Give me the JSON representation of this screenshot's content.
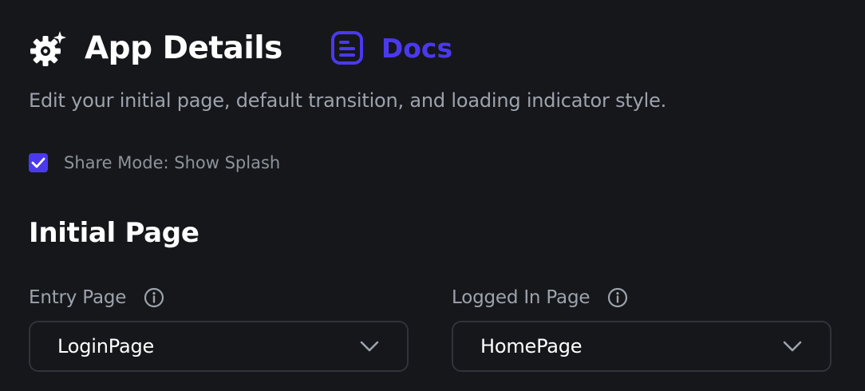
{
  "header": {
    "title": "App Details",
    "docs_label": "Docs",
    "gear_icon": "gear-sparkle-icon",
    "docs_icon": "document-icon",
    "accent_color": "#4b39ef"
  },
  "subtitle": "Edit your initial page, default transition, and loading indicator style.",
  "share_mode": {
    "label": "Share Mode: Show Splash",
    "checked": true
  },
  "initial_page": {
    "title": "Initial Page",
    "entry_page": {
      "label": "Entry Page",
      "value": "LoginPage"
    },
    "logged_in_page": {
      "label": "Logged In Page",
      "value": "HomePage"
    }
  }
}
